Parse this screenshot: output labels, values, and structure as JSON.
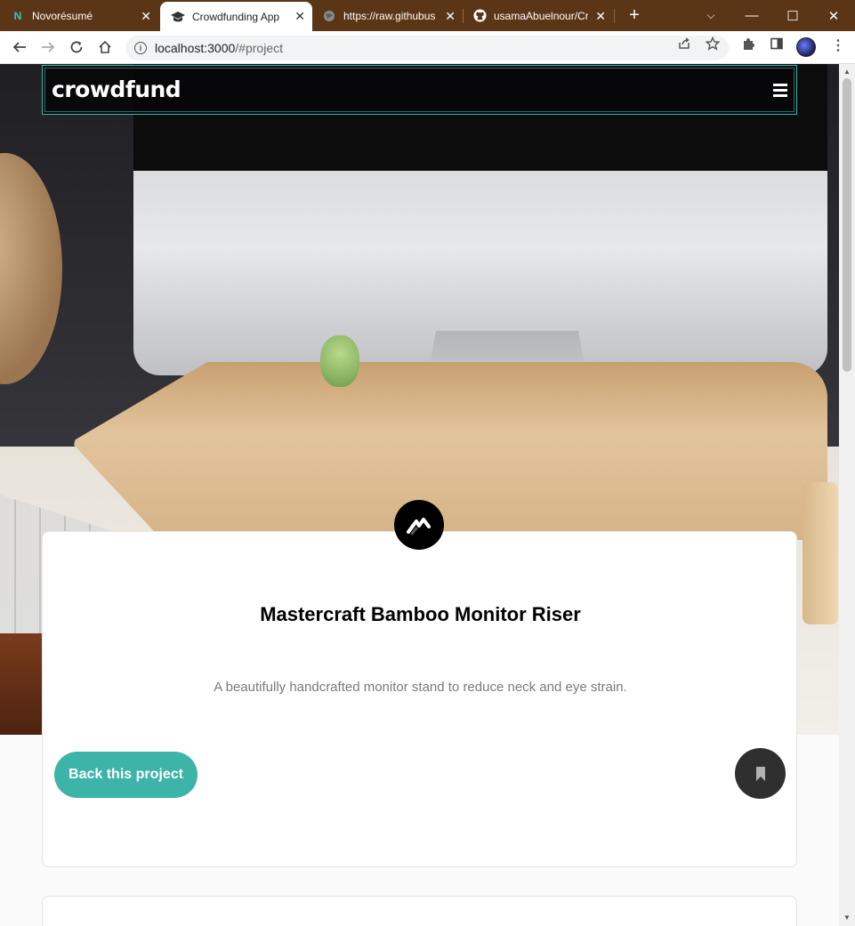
{
  "browser": {
    "tabs": [
      {
        "title": "Novorésumé",
        "icon": "novoresume-icon"
      },
      {
        "title": "Crowdfunding App",
        "icon": "graduation-cap-icon"
      },
      {
        "title": "https://raw.githubus",
        "icon": "globe-icon"
      },
      {
        "title": "usamaAbuelnour/Cr",
        "icon": "github-icon"
      }
    ],
    "active_tab_index": 1,
    "url_host": "localhost:3000",
    "url_path": "/#project"
  },
  "header": {
    "brand": "crowdfund"
  },
  "project": {
    "title": "Mastercraft Bamboo Monitor Riser",
    "description": "A beautifully handcrafted monitor stand to reduce neck and eye strain.",
    "back_label": "Back this project"
  },
  "colors": {
    "accent": "#3cb4a8",
    "tabbar": "#5a3616",
    "bookmark_bg": "#2f2f2f"
  }
}
